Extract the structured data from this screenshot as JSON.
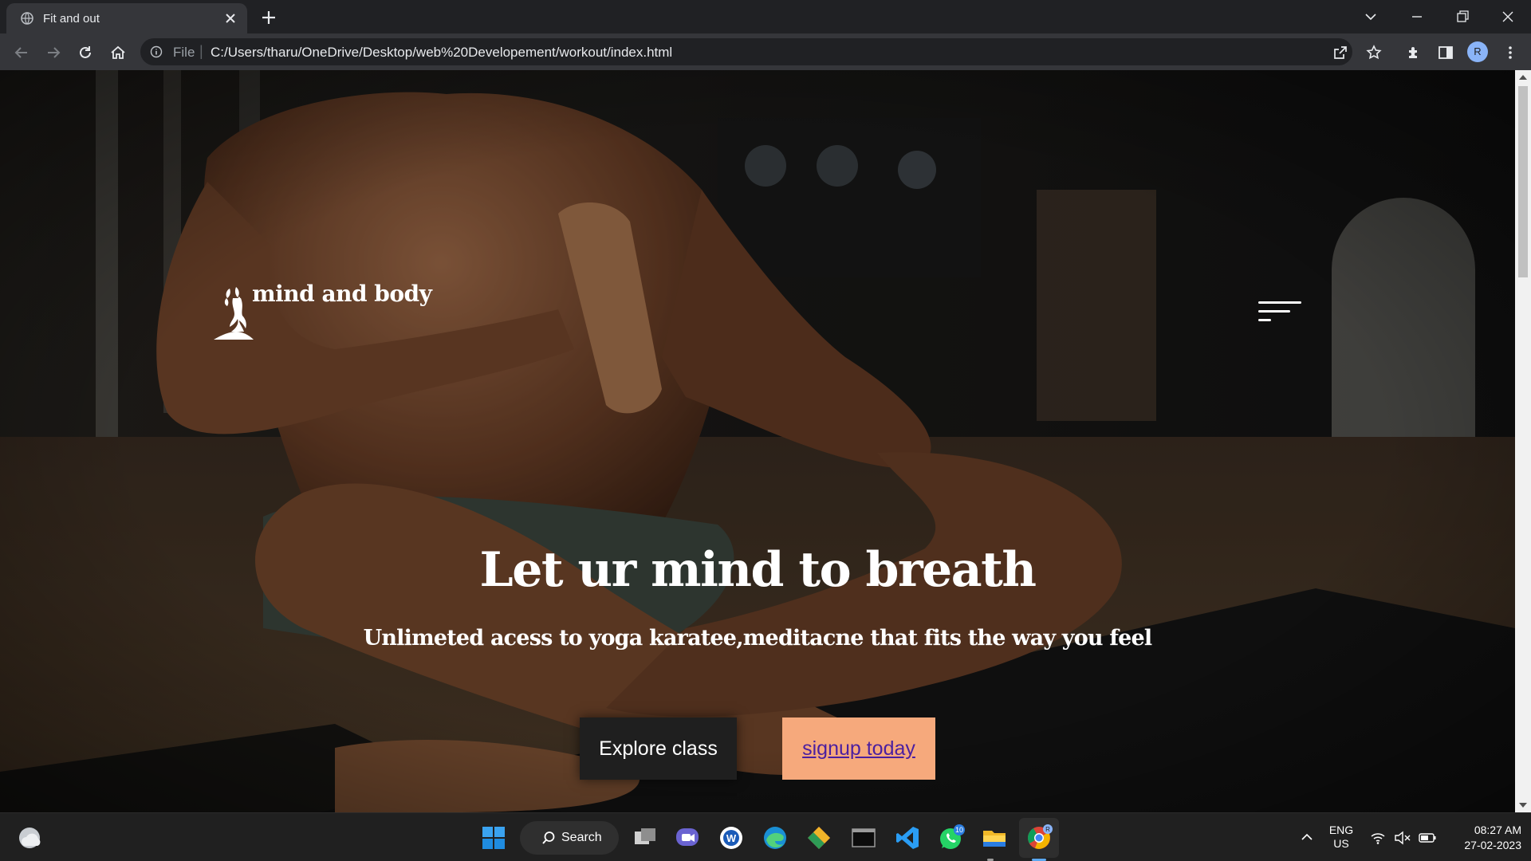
{
  "browser": {
    "tab_title": "Fit and out",
    "omnibox_scheme": "File",
    "url": "C:/Users/tharu/OneDrive/Desktop/web%20Developement/workout/index.html",
    "profile_initial": "R"
  },
  "page": {
    "brand": "mind and body",
    "hero_title": "Let ur mind to breath",
    "hero_subtitle": "Unlimeted acess to yoga karatee,meditacne that fits the way you feel",
    "explore_button": "Explore class",
    "signup_button": "signup today",
    "colors": {
      "signup_bg": "#f6a97c",
      "signup_text": "#4b1fa0",
      "explore_bg": "#1f1f1f"
    }
  },
  "taskbar": {
    "search_label": "Search",
    "whatsapp_badge": "10",
    "chrome_badge": "R",
    "lang_top": "ENG",
    "lang_bottom": "US",
    "time": "08:27 AM",
    "date": "27-02-2023",
    "icons": [
      "weather-icon",
      "windows-start-icon",
      "search-icon",
      "task-view-icon",
      "teams-chat-icon",
      "word-icon",
      "edge-icon",
      "git-icon",
      "terminal-icon",
      "vscode-icon",
      "whatsapp-icon",
      "file-explorer-icon",
      "chrome-icon"
    ]
  }
}
